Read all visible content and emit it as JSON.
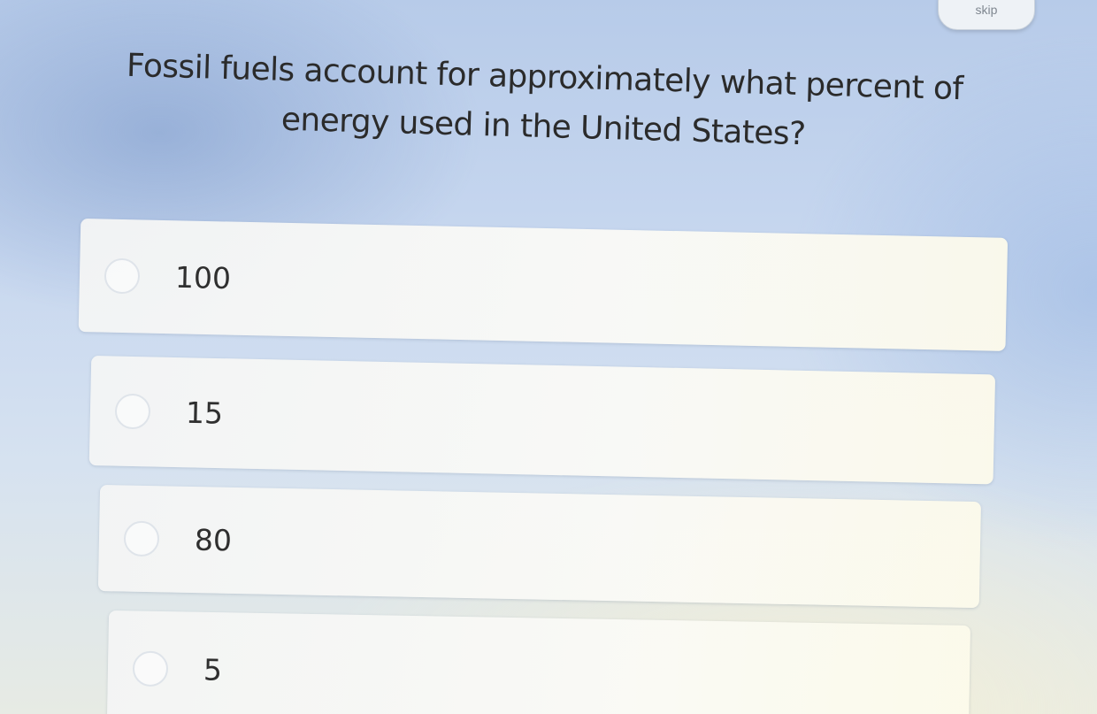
{
  "header": {
    "skip_label": "skip"
  },
  "question": {
    "line1": "Fossil fuels account for approximately what percent of",
    "line2": "energy used in the United States?"
  },
  "options": [
    {
      "label": "100"
    },
    {
      "label": "15"
    },
    {
      "label": "80"
    },
    {
      "label": "5"
    }
  ],
  "colors": {
    "background": "#c7d7ef",
    "option_fill": "#f6f6f2",
    "text": "#2b2b2b"
  }
}
